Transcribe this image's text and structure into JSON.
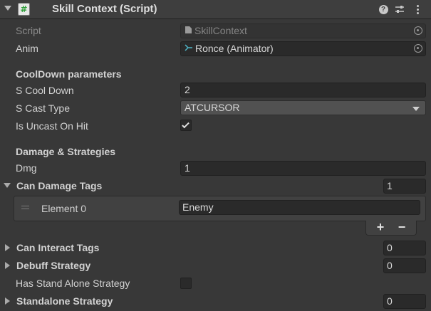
{
  "header": {
    "title": "Skill Context (Script)",
    "icons": [
      "fold-arrow-icon",
      "csharp-script-icon",
      "help-icon",
      "presets-icon",
      "context-menu-icon"
    ]
  },
  "script": {
    "label": "Script",
    "value": "SkillContext",
    "icon": "script-file-icon"
  },
  "anim": {
    "label": "Anim",
    "value": "Ronce (Animator)",
    "icon": "animator-icon"
  },
  "cooldown": {
    "section": "CoolDown parameters",
    "cooldown_label": "S Cool Down",
    "cooldown_value": "2",
    "cast_type_label": "S Cast Type",
    "cast_type_value": "ATCURSOR",
    "uncast_label": "Is Uncast On Hit",
    "uncast_checked": true
  },
  "damage": {
    "section": "Damage & Strategies",
    "dmg_label": "Dmg",
    "dmg_value": "1",
    "can_damage_tags": {
      "label": "Can Damage Tags",
      "count": "1",
      "elements": [
        {
          "label": "Element 0",
          "value": "Enemy"
        }
      ],
      "add": "+",
      "remove": "−"
    },
    "can_interact_tags": {
      "label": "Can Interact Tags",
      "count": "0"
    },
    "debuff_strategy": {
      "label": "Debuff Strategy",
      "count": "0"
    },
    "has_standalone": {
      "label": "Has Stand Alone Strategy",
      "checked": false
    },
    "standalone_strategy": {
      "label": "Standalone Strategy",
      "count": "0"
    }
  },
  "colors": {
    "background": "#383838",
    "header": "#3e3e3e",
    "field": "#2a2a2a",
    "script_green": "#2f9e3a",
    "animator_teal": "#4fb6c8"
  }
}
